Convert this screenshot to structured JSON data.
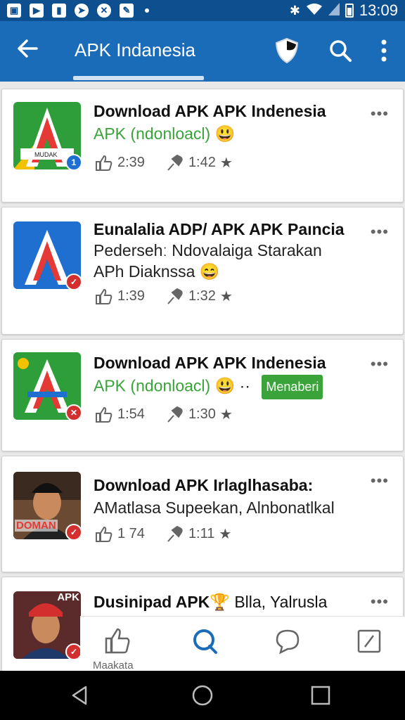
{
  "status_bar": {
    "time": "13:09",
    "left_icons": [
      "gallery-icon",
      "play-store-icon",
      "bookmark-icon",
      "navigation-icon",
      "xbox-icon",
      "edit-icon"
    ]
  },
  "appbar": {
    "title": "APK Indanesia",
    "color": "#1a6bb8",
    "status_color": "#0d4f8f"
  },
  "apps": [
    {
      "title": "Download APK APK Indenesia",
      "subtitle": "APK (ndonloacl)",
      "likes": "2:39",
      "rating": "1:42",
      "badge": "1",
      "badge_color": "#1e6fd0"
    },
    {
      "title": "Eunalalia ADP/ APK APK Paıncia",
      "line2": "Pedersehː Ndovalaiga Starakan",
      "line3": "APh Diaknssa",
      "likes": "1:39",
      "rating": "1:32",
      "badge_color": "#d32f2f"
    },
    {
      "title": "Download APK APK Indenesia",
      "subtitle": "APK (ndonloacl)",
      "tag": "Menaberi",
      "likes": "1:54",
      "rating": "1:30",
      "badge_color": "#d32f2f"
    },
    {
      "title": "Download APK Irlaglhasaba:",
      "line2": "AMatlasa Supeekan, Alnbonatlkal",
      "icon_text": "DOMAN",
      "likes": "1 74",
      "rating": "1:11",
      "badge_color": "#d32f2f"
    },
    {
      "title": "Dusinipad APK",
      "title_rest": "Blla, Yalrusla",
      "icon_text": "APK",
      "badge_color": "#d32f2f"
    }
  ],
  "tabs": {
    "first_label": "Maakata"
  },
  "accent_green": "#3aa33a"
}
